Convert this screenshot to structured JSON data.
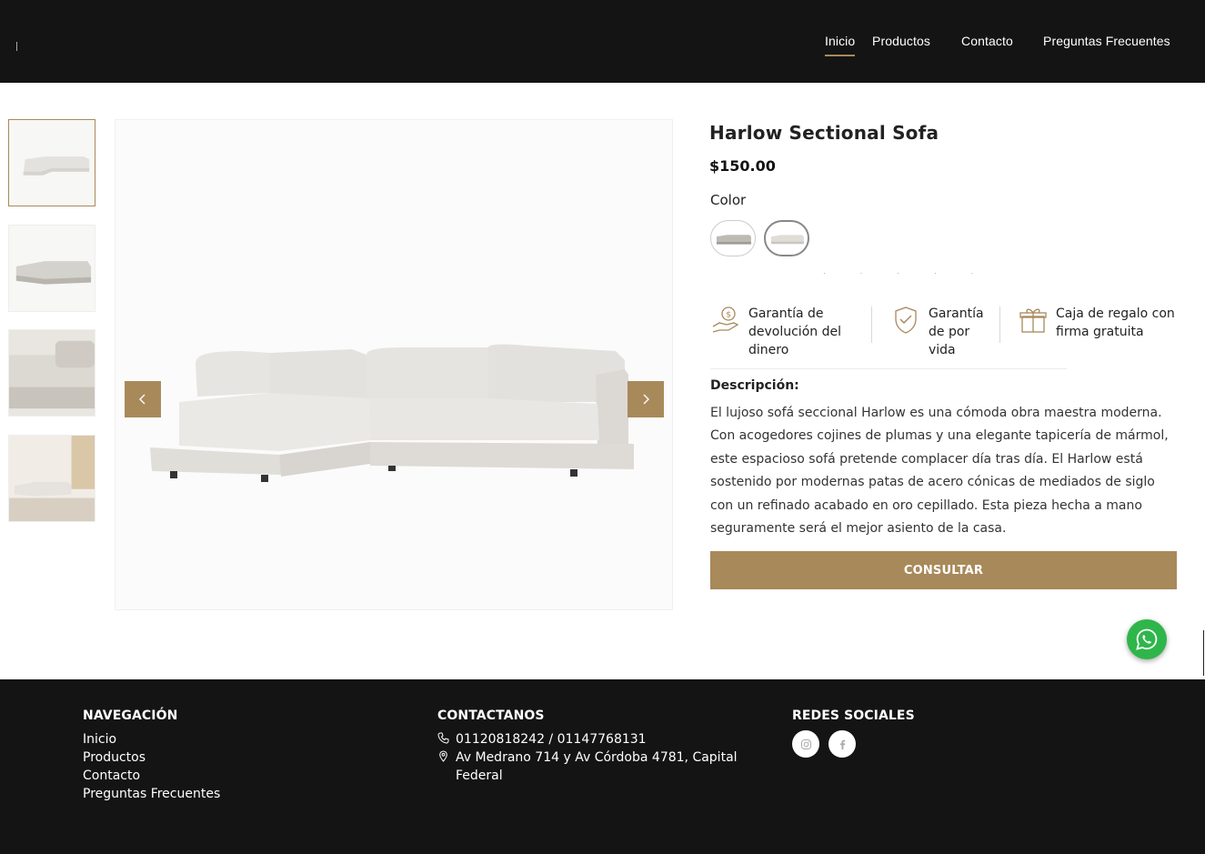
{
  "nav": {
    "items": [
      {
        "label": "Inicio",
        "active": true
      },
      {
        "label": "Productos",
        "active": false
      },
      {
        "label": "Contacto",
        "active": false
      },
      {
        "label": "Preguntas Frecuentes",
        "active": false
      }
    ]
  },
  "product": {
    "title": "Harlow Sectional Sofa",
    "price": "$150.00",
    "color_label": "Color",
    "features": [
      {
        "icon": "hand-money-icon",
        "text": "Garantía de devolución del dinero"
      },
      {
        "icon": "shield-check-icon",
        "text": "Garantía de por vida"
      },
      {
        "icon": "gift-box-icon",
        "text": "Caja de regalo con firma gratuita"
      }
    ],
    "description_label": "Descripción:",
    "description": "El lujoso sofá seccional Harlow es una cómoda obra maestra moderna. Con acogedores cojines de plumas y una elegante tapicería de mármol, este espacioso sofá pretende complacer día tras día. El Harlow está sostenido por modernas patas de acero cónicas de mediados de siglo con un refinado acabado en oro cepillado. Esta pieza hecha a mano seguramente será el mejor asiento de la casa.",
    "cta_label": "CONSULTAR"
  },
  "gallery": {
    "thumbnail_count": 4,
    "selected_index": 0
  },
  "footer": {
    "navigation": {
      "title": "NAVEGACIÓN",
      "links": [
        "Inicio",
        "Productos",
        "Contacto",
        "Preguntas Frecuentes"
      ]
    },
    "contact": {
      "title": "CONTACTANOS",
      "phone": "01120818242 / 01147768131",
      "address": "Av Medrano 714 y Av Córdoba 4781, Capital Federal"
    },
    "social": {
      "title": "REDES SOCIALES",
      "networks": [
        "instagram-icon",
        "facebook-icon"
      ]
    }
  },
  "colors": {
    "accent": "#a8895a",
    "header_bg": "#141414",
    "whatsapp": "#2fb64a"
  }
}
